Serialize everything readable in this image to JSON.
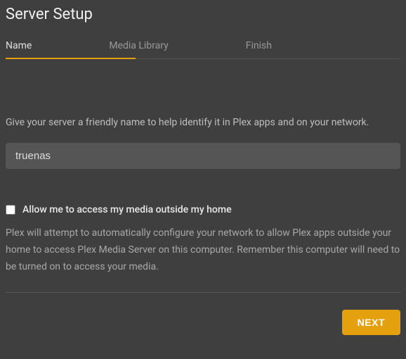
{
  "header": {
    "title": "Server Setup"
  },
  "tabs": [
    {
      "label": "Name",
      "active": true
    },
    {
      "label": "Media Library",
      "active": false
    },
    {
      "label": "Finish",
      "active": false
    }
  ],
  "form": {
    "description": "Give your server a friendly name to help identify it in Plex apps and on your network.",
    "server_name_value": "truenas",
    "allow_outside_label": "Allow me to access my media outside my home",
    "allow_outside_checked": false,
    "help_text": "Plex will attempt to automatically configure your network to allow Plex apps outside your home to access Plex Media Server on this computer. Remember this computer will need to be turned on to access your media."
  },
  "buttons": {
    "next": "NEXT"
  }
}
